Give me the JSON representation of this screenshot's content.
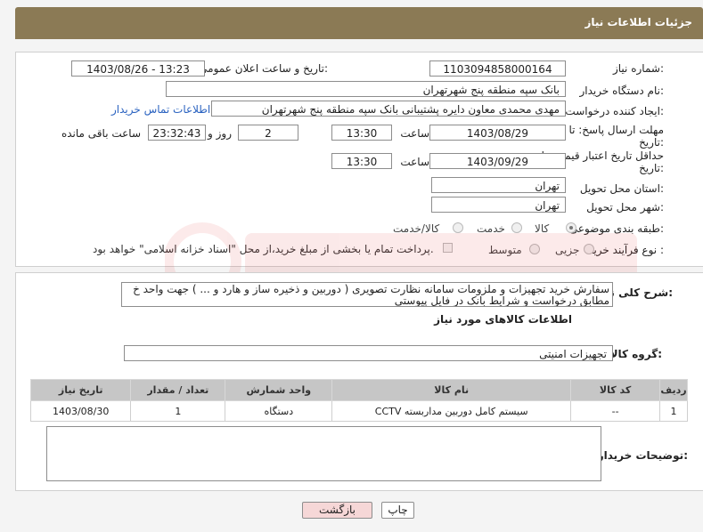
{
  "header": {
    "title": "جزئیات اطلاعات نیاز"
  },
  "form": {
    "need_number_label": "شماره نیاز:",
    "need_number": "1103094858000164",
    "announce_label": "تاریخ و ساعت اعلان عمومی:",
    "announce_value": "1403/08/26 - 13:23",
    "buyer_org_label": "نام دستگاه خریدار:",
    "buyer_org": "بانک سپه منطقه پنج شهرتهران",
    "creator_label": "ایجاد کننده درخواست:",
    "creator": "مهدی محمدی معاون دایره پشتیبانی بانک سپه منطقه پنج شهرتهران",
    "contact_link": "اطلاعات تماس خریدار",
    "reply_deadline_label": "مهلت ارسال پاسخ: تا",
    "reply_deadline_label2": "تاریخ:",
    "reply_date": "1403/08/29",
    "time_label": "ساعت",
    "reply_time": "13:30",
    "days_value": "2",
    "days_label": "روز و",
    "remaining_value": "23:32:43",
    "remaining_label": "ساعت باقی مانده",
    "price_deadline_label": "حداقل تاریخ اعتبار قیمت: تا",
    "price_deadline_label2": "تاریخ:",
    "price_date": "1403/09/29",
    "price_time": "13:30",
    "province_label": "استان محل تحویل:",
    "province": "تهران",
    "city_label": "شهر محل تحویل:",
    "city": "تهران",
    "category_label": "طبقه بندی موضوعی:",
    "category_options": [
      "کالا",
      "خدمت",
      "کالا/خدمت"
    ],
    "process_label": "نوع فرآیند خرید :",
    "process_options": [
      "جزیی",
      "متوسط"
    ],
    "payment_note": "پرداخت تمام یا بخشی از مبلغ خرید،از محل \"اسناد خزانه اسلامی\" خواهد بود."
  },
  "details": {
    "desc_label": "شرح کلی نیاز:",
    "desc_line1": "سفارش خرید تجهیزات و ملزومات سامانه نظارت تصویری ( دوربین و ذخیره ساز و هارد و ... ) جهت واحد خ",
    "desc_line2": "مطابق درخواست و شرایط بانک در فایل پیوستی",
    "goods_info_title": "اطلاعات کالاهای مورد نیاز",
    "goods_group_label": "گروه کالا:",
    "goods_group": "تجهیزات امنیتی",
    "table_headers": [
      "ردیف",
      "کد کالا",
      "نام کالا",
      "واحد شمارش",
      "تعداد / مقدار",
      "تاریخ نیاز"
    ],
    "rows": [
      [
        "1",
        "--",
        "سیستم کامل دوربین مداربسته CCTV",
        "دستگاه",
        "1",
        "1403/08/30"
      ]
    ],
    "buyer_notes_label": "توضیحات خریدار:"
  },
  "buttons": {
    "print": "چاپ",
    "back": "بازگشت"
  },
  "colors": {
    "header": "#8b7a55",
    "link": "#2b63c0",
    "back_button": "#f6d7d7"
  }
}
